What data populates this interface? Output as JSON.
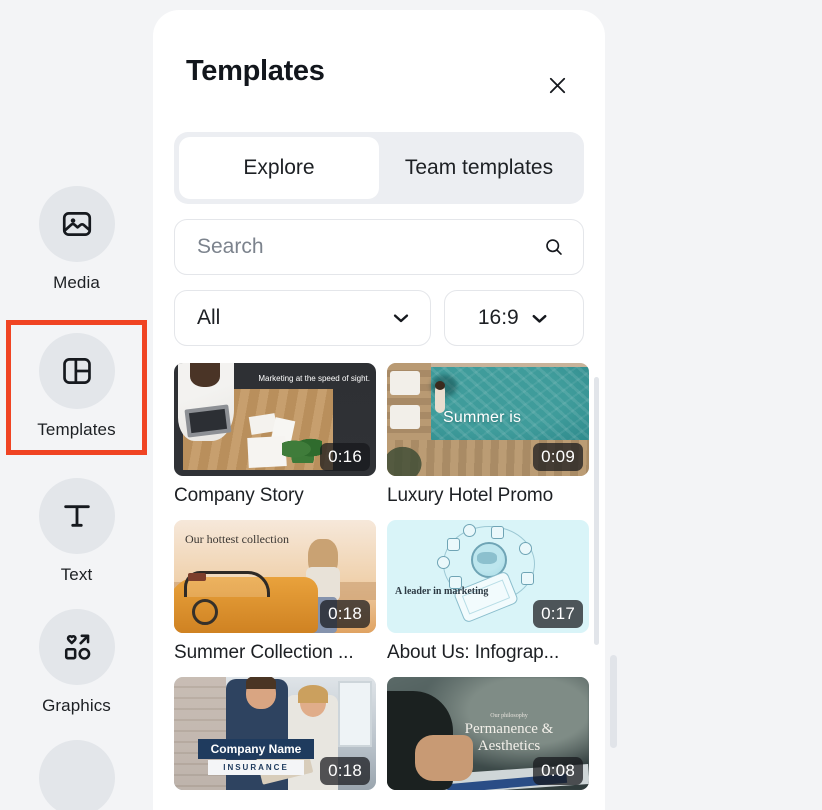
{
  "sidebar": {
    "items": [
      {
        "label": "Media",
        "icon": "image-icon",
        "highlighted": false
      },
      {
        "label": "Templates",
        "icon": "layout-template-icon",
        "highlighted": true
      },
      {
        "label": "Text",
        "icon": "text-t-icon",
        "highlighted": false
      },
      {
        "label": "Graphics",
        "icon": "graphics-shapes-icon",
        "highlighted": false
      }
    ],
    "highlight_color": "#f04423"
  },
  "panel": {
    "title": "Templates",
    "close_icon": "close-icon",
    "tabs": [
      {
        "label": "Explore",
        "active": true
      },
      {
        "label": "Team templates",
        "active": false
      }
    ],
    "search": {
      "placeholder": "Search",
      "value": "",
      "icon": "search-icon"
    },
    "filters": [
      {
        "name": "category",
        "value": "All",
        "icon": "chevron-down-icon"
      },
      {
        "name": "aspect-ratio",
        "value": "16:9",
        "icon": "chevron-down-icon"
      }
    ],
    "templates": [
      {
        "title": "Company Story",
        "duration": "0:16",
        "overlay_text": "Marketing at the speed of sight."
      },
      {
        "title": "Luxury Hotel Promo",
        "duration": "0:09",
        "overlay_text": "Summer is"
      },
      {
        "title": "Summer Collection ...",
        "duration": "0:18",
        "overlay_text": "Our hottest collection"
      },
      {
        "title": "About Us: Infograp...",
        "duration": "0:17",
        "overlay_text": "A leader in marketing"
      },
      {
        "title": "",
        "duration": "0:18",
        "overlay_text": "Company Name",
        "overlay_subtext": "INSURANCE"
      },
      {
        "title": "",
        "duration": "0:08",
        "overlay_text": "Permanence & Aesthetics",
        "overlay_subtext": "Our philosophy"
      }
    ]
  }
}
